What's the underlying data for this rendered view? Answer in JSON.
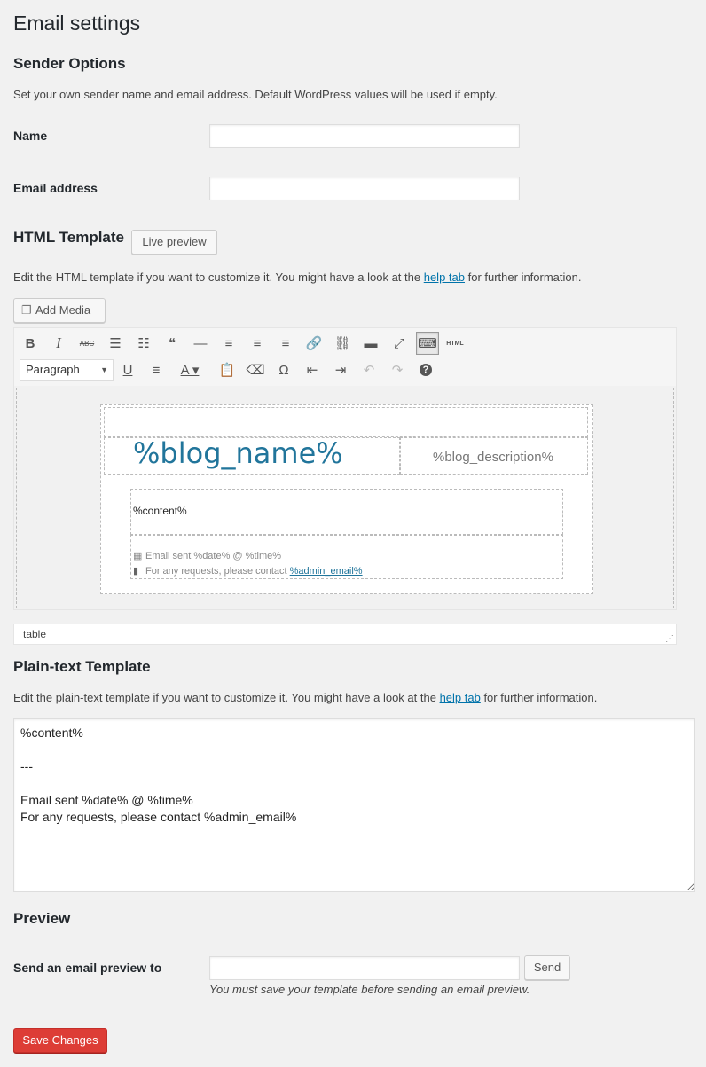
{
  "page": {
    "title": "Email settings"
  },
  "sender": {
    "heading": "Sender Options",
    "description": "Set your own sender name and email address. Default WordPress values will be used if empty.",
    "name_label": "Name",
    "name_value": "",
    "email_label": "Email address",
    "email_value": ""
  },
  "html_template": {
    "heading": "HTML Template",
    "live_preview_label": "Live preview",
    "desc_before": "Edit the HTML template if you want to customize it. You might have a look at the ",
    "help_link": "help tab",
    "desc_after": " for further information.",
    "add_media_label": "Add Media",
    "toolbar_row1": [
      {
        "icon": "bold-icon",
        "glyph": "B"
      },
      {
        "icon": "italic-icon",
        "glyph": "I"
      },
      {
        "icon": "strikethrough-icon",
        "glyph": "ABC"
      },
      {
        "icon": "bulleted-list-icon",
        "glyph": "☰"
      },
      {
        "icon": "numbered-list-icon",
        "glyph": "☷"
      },
      {
        "icon": "blockquote-icon",
        "glyph": "❝"
      },
      {
        "icon": "horizontal-line-icon",
        "glyph": "—"
      },
      {
        "icon": "align-left-icon",
        "glyph": "≡"
      },
      {
        "icon": "align-center-icon",
        "glyph": "≡"
      },
      {
        "icon": "align-right-icon",
        "glyph": "≡"
      },
      {
        "icon": "insert-link-icon",
        "glyph": "🔗"
      },
      {
        "icon": "remove-link-icon",
        "glyph": "⛓"
      },
      {
        "icon": "read-more-icon",
        "glyph": "▬"
      },
      {
        "icon": "fullscreen-icon",
        "glyph": "⤢"
      },
      {
        "icon": "toolbar-toggle-icon",
        "glyph": "⌨"
      },
      {
        "icon": "html-icon",
        "glyph": "HTML"
      }
    ],
    "format_select": "Paragraph",
    "toolbar_row2": [
      {
        "icon": "underline-icon",
        "glyph": "U"
      },
      {
        "icon": "justify-icon",
        "glyph": "≡"
      },
      {
        "icon": "text-color-icon",
        "glyph": "A"
      },
      {
        "icon": "paste-text-icon",
        "glyph": "📋"
      },
      {
        "icon": "clear-formatting-icon",
        "glyph": "⌫"
      },
      {
        "icon": "special-character-icon",
        "glyph": "Ω"
      },
      {
        "icon": "outdent-icon",
        "glyph": "⇤"
      },
      {
        "icon": "indent-icon",
        "glyph": "⇥"
      },
      {
        "icon": "undo-icon",
        "glyph": "↶"
      },
      {
        "icon": "redo-icon",
        "glyph": "↷"
      },
      {
        "icon": "help-icon",
        "glyph": "?"
      }
    ],
    "content": {
      "blog_name": "%blog_name%",
      "blog_description": "%blog_description%",
      "content_placeholder": "%content%",
      "footer_sent": "Email sent %date% @ %time%",
      "footer_contact": "For any requests, please contact ",
      "footer_email": "%admin_email%"
    },
    "status_path": "table"
  },
  "plain_template": {
    "heading": "Plain-text Template",
    "desc_before": "Edit the plain-text template if you want to customize it. You might have a look at the ",
    "help_link": "help tab",
    "desc_after": " for further information.",
    "value": "%content%\n\n---\n\nEmail sent %date% @ %time%\nFor any requests, please contact %admin_email%"
  },
  "preview": {
    "heading": "Preview",
    "label": "Send an email preview to",
    "input_value": "",
    "send_label": "Send",
    "note": "You must save your template before sending an email preview."
  },
  "save_label": "Save Changes"
}
